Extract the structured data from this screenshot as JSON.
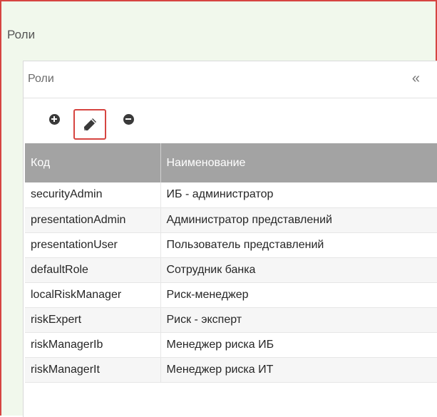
{
  "outer": {
    "title": "Роли"
  },
  "panel": {
    "title": "Роли",
    "collapse_glyph": "«"
  },
  "toolbar": {
    "add_icon": "plus-circle-icon",
    "edit_icon": "pencil-icon",
    "remove_icon": "minus-circle-icon"
  },
  "table": {
    "columns": [
      "Код",
      "Наименование"
    ],
    "rows": [
      {
        "code": "securityAdmin",
        "name": "ИБ - администратор"
      },
      {
        "code": "presentationAdmin",
        "name": "Администратор представлений"
      },
      {
        "code": "presentationUser",
        "name": "Пользователь представлений"
      },
      {
        "code": "defaultRole",
        "name": "Сотрудник банка"
      },
      {
        "code": "localRiskManager",
        "name": "Риск-менеджер"
      },
      {
        "code": "riskExpert",
        "name": "Риск - эксперт"
      },
      {
        "code": "riskManagerIb",
        "name": "Менеджер риска ИБ"
      },
      {
        "code": "riskManagerIt",
        "name": "Менеджер риска ИТ"
      }
    ]
  },
  "colors": {
    "highlight_border": "#d64541",
    "header_bg": "#f1f8ec",
    "table_header_bg": "#a3a3a3"
  }
}
